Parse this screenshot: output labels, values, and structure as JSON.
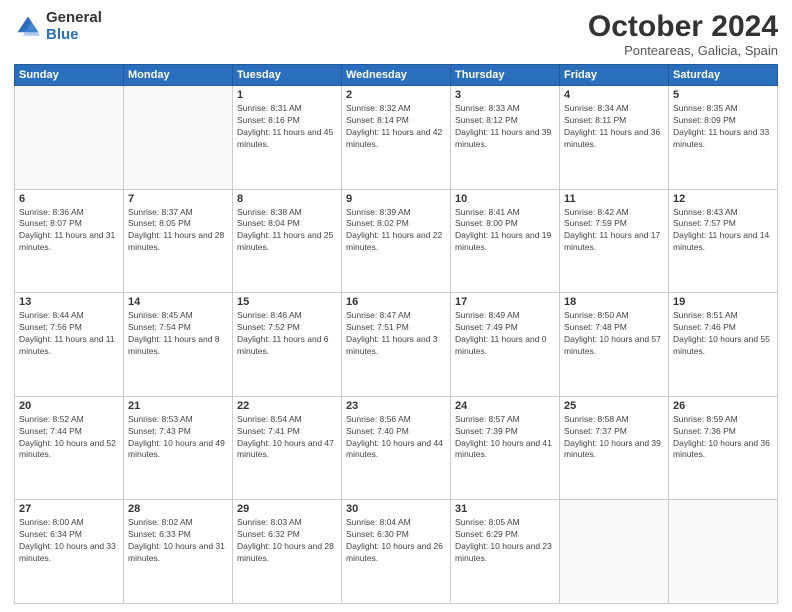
{
  "logo": {
    "general": "General",
    "blue": "Blue"
  },
  "header": {
    "title": "October 2024",
    "subtitle": "Ponteareas, Galicia, Spain"
  },
  "weekdays": [
    "Sunday",
    "Monday",
    "Tuesday",
    "Wednesday",
    "Thursday",
    "Friday",
    "Saturday"
  ],
  "weeks": [
    [
      null,
      null,
      {
        "day": 1,
        "sunrise": "8:31 AM",
        "sunset": "8:16 PM",
        "daylight": "11 hours and 45 minutes."
      },
      {
        "day": 2,
        "sunrise": "8:32 AM",
        "sunset": "8:14 PM",
        "daylight": "11 hours and 42 minutes."
      },
      {
        "day": 3,
        "sunrise": "8:33 AM",
        "sunset": "8:12 PM",
        "daylight": "11 hours and 39 minutes."
      },
      {
        "day": 4,
        "sunrise": "8:34 AM",
        "sunset": "8:11 PM",
        "daylight": "11 hours and 36 minutes."
      },
      {
        "day": 5,
        "sunrise": "8:35 AM",
        "sunset": "8:09 PM",
        "daylight": "11 hours and 33 minutes."
      }
    ],
    [
      {
        "day": 6,
        "sunrise": "8:36 AM",
        "sunset": "8:07 PM",
        "daylight": "11 hours and 31 minutes."
      },
      {
        "day": 7,
        "sunrise": "8:37 AM",
        "sunset": "8:05 PM",
        "daylight": "11 hours and 28 minutes."
      },
      {
        "day": 8,
        "sunrise": "8:38 AM",
        "sunset": "8:04 PM",
        "daylight": "11 hours and 25 minutes."
      },
      {
        "day": 9,
        "sunrise": "8:39 AM",
        "sunset": "8:02 PM",
        "daylight": "11 hours and 22 minutes."
      },
      {
        "day": 10,
        "sunrise": "8:41 AM",
        "sunset": "8:00 PM",
        "daylight": "11 hours and 19 minutes."
      },
      {
        "day": 11,
        "sunrise": "8:42 AM",
        "sunset": "7:59 PM",
        "daylight": "11 hours and 17 minutes."
      },
      {
        "day": 12,
        "sunrise": "8:43 AM",
        "sunset": "7:57 PM",
        "daylight": "11 hours and 14 minutes."
      }
    ],
    [
      {
        "day": 13,
        "sunrise": "8:44 AM",
        "sunset": "7:56 PM",
        "daylight": "11 hours and 11 minutes."
      },
      {
        "day": 14,
        "sunrise": "8:45 AM",
        "sunset": "7:54 PM",
        "daylight": "11 hours and 8 minutes."
      },
      {
        "day": 15,
        "sunrise": "8:46 AM",
        "sunset": "7:52 PM",
        "daylight": "11 hours and 6 minutes."
      },
      {
        "day": 16,
        "sunrise": "8:47 AM",
        "sunset": "7:51 PM",
        "daylight": "11 hours and 3 minutes."
      },
      {
        "day": 17,
        "sunrise": "8:49 AM",
        "sunset": "7:49 PM",
        "daylight": "11 hours and 0 minutes."
      },
      {
        "day": 18,
        "sunrise": "8:50 AM",
        "sunset": "7:48 PM",
        "daylight": "10 hours and 57 minutes."
      },
      {
        "day": 19,
        "sunrise": "8:51 AM",
        "sunset": "7:46 PM",
        "daylight": "10 hours and 55 minutes."
      }
    ],
    [
      {
        "day": 20,
        "sunrise": "8:52 AM",
        "sunset": "7:44 PM",
        "daylight": "10 hours and 52 minutes."
      },
      {
        "day": 21,
        "sunrise": "8:53 AM",
        "sunset": "7:43 PM",
        "daylight": "10 hours and 49 minutes."
      },
      {
        "day": 22,
        "sunrise": "8:54 AM",
        "sunset": "7:41 PM",
        "daylight": "10 hours and 47 minutes."
      },
      {
        "day": 23,
        "sunrise": "8:56 AM",
        "sunset": "7:40 PM",
        "daylight": "10 hours and 44 minutes."
      },
      {
        "day": 24,
        "sunrise": "8:57 AM",
        "sunset": "7:39 PM",
        "daylight": "10 hours and 41 minutes."
      },
      {
        "day": 25,
        "sunrise": "8:58 AM",
        "sunset": "7:37 PM",
        "daylight": "10 hours and 39 minutes."
      },
      {
        "day": 26,
        "sunrise": "8:59 AM",
        "sunset": "7:36 PM",
        "daylight": "10 hours and 36 minutes."
      }
    ],
    [
      {
        "day": 27,
        "sunrise": "8:00 AM",
        "sunset": "6:34 PM",
        "daylight": "10 hours and 33 minutes."
      },
      {
        "day": 28,
        "sunrise": "8:02 AM",
        "sunset": "6:33 PM",
        "daylight": "10 hours and 31 minutes."
      },
      {
        "day": 29,
        "sunrise": "8:03 AM",
        "sunset": "6:32 PM",
        "daylight": "10 hours and 28 minutes."
      },
      {
        "day": 30,
        "sunrise": "8:04 AM",
        "sunset": "6:30 PM",
        "daylight": "10 hours and 26 minutes."
      },
      {
        "day": 31,
        "sunrise": "8:05 AM",
        "sunset": "6:29 PM",
        "daylight": "10 hours and 23 minutes."
      },
      null,
      null
    ]
  ]
}
